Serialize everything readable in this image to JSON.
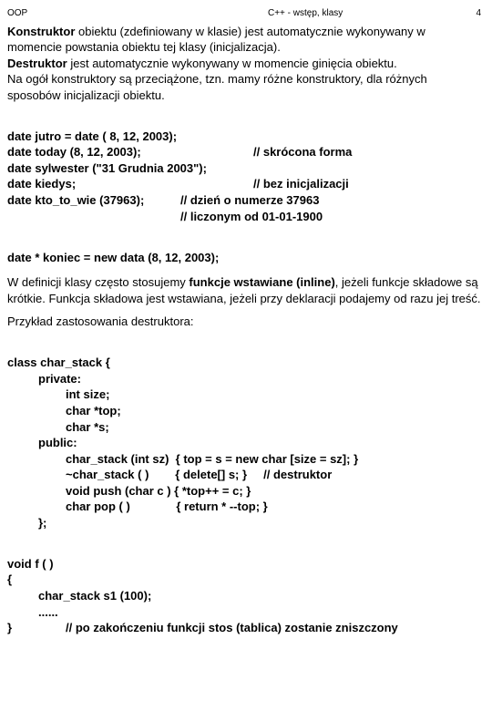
{
  "header": {
    "left": "OOP",
    "mid": "C++ - wstęp, klasy",
    "page": "4"
  },
  "p1": {
    "s1a": "Konstruktor",
    "s1b": " obiektu (zdefiniowany w klasie) jest automatycznie wykonywany w momencie powstania obiektu tej klasy (inicjalizacja).",
    "s2a": "Destruktor",
    "s2b": " jest automatycznie wykonywany w momencie ginięcia obiektu.",
    "s3": "Na ogół konstruktory są przeciążone, tzn. mamy różne konstruktory, dla różnych sposobów inicjalizacji obiektu."
  },
  "code1": {
    "l1": "date jutro = date ( 8, 12, 2003);",
    "l2a": "date today (8, 12, 2003);",
    "l2b": "// skrócona forma",
    "l3": "date sylwester (\"31 Grudnia 2003\");",
    "l4a": "date kiedys;",
    "l4b": "// bez inicjalizacji",
    "l5a": "date kto_to_wie (37963);",
    "l5b": "// dzień o numerze 37963",
    "l6": "// liczonym od 01-01-1900"
  },
  "code2": "date * koniec = new data (8, 12, 2003);",
  "p2": {
    "s1a": "W definicji klasy często stosujemy ",
    "s1b": "funkcje wstawiane (inline)",
    "s1c": ", jeżeli funkcje składowe są krótkie. Funkcja składowa jest wstawiana, jeżeli przy deklaracji podajemy od razu jej treść."
  },
  "p3": "Przykład zastosowania destruktora:",
  "code3": {
    "l1": "class char_stack {",
    "l2": "private:",
    "l3": "int size;",
    "l4": "char *top;",
    "l5": "char *s;",
    "l6": "public:",
    "l7": "char_stack (int sz)  { top = s = new char [size = sz]; }",
    "l8a": "~char_stack ( )        { delete[] s; }",
    "l8b": "// destruktor",
    "l9": "void push (char c ) { *top++ = c; }",
    "l10": "char pop ( )              { return * --top; }",
    "l11": "};"
  },
  "code4": {
    "l1": "void f ( )",
    "l2": "{",
    "l3": "char_stack s1 (100);",
    "l4": "......",
    "l5a": "}",
    "l5b": "// po zakończeniu funkcji stos (tablica) zostanie zniszczony"
  }
}
